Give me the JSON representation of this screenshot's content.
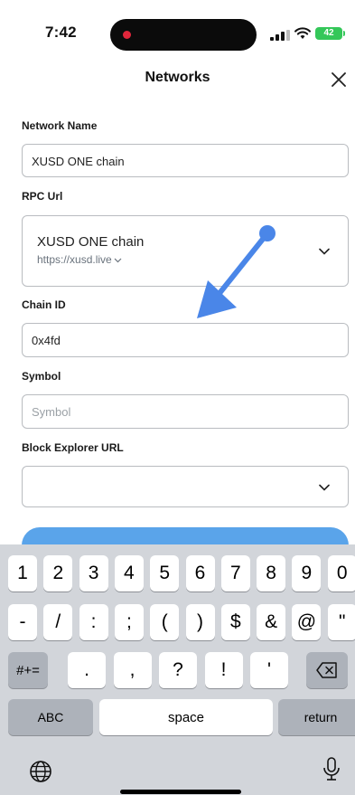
{
  "status_bar": {
    "time": "7:42",
    "battery": "42"
  },
  "header": {
    "title": "Networks"
  },
  "form": {
    "network_name": {
      "label": "Network Name",
      "value": "XUSD ONE chain"
    },
    "rpc_url": {
      "label": "RPC Url",
      "name": "XUSD ONE chain",
      "url": "https://xusd.live"
    },
    "chain_id": {
      "label": "Chain ID",
      "value": "0x4fd"
    },
    "symbol": {
      "label": "Symbol",
      "placeholder": "Symbol"
    },
    "block_explorer": {
      "label": "Block Explorer URL",
      "value": ""
    }
  },
  "keyboard": {
    "row1": [
      "1",
      "2",
      "3",
      "4",
      "5",
      "6",
      "7",
      "8",
      "9",
      "0"
    ],
    "row2": [
      "-",
      "/",
      ":",
      ";",
      "(",
      ")",
      "$",
      "&",
      "@",
      "\""
    ],
    "row3": {
      "shift": "#+=",
      "keys": [
        ".",
        ",",
        "?",
        "!",
        "'"
      ]
    },
    "bottom": {
      "abc": "ABC",
      "space": "space",
      "return": "return"
    }
  },
  "colors": {
    "accent": "#5aa4ea",
    "arrow": "#4a86e8",
    "battery": "#34c759"
  }
}
